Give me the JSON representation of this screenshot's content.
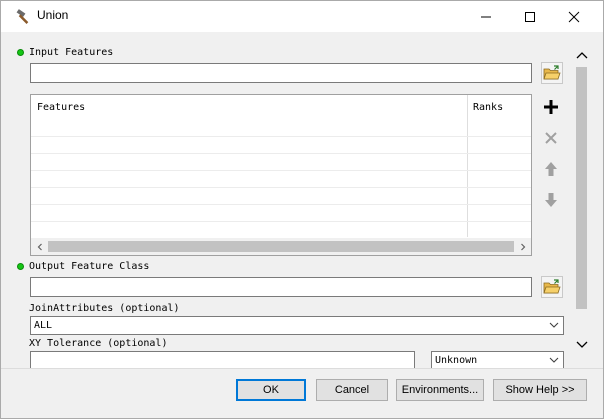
{
  "window": {
    "title": "Union",
    "icon": "hammer-icon"
  },
  "input_features": {
    "label": "Input Features",
    "value": ""
  },
  "features_table": {
    "columns": [
      "Features",
      "Ranks"
    ],
    "rows": []
  },
  "output_feature_class": {
    "label": "Output Feature Class",
    "value": ""
  },
  "join_attributes": {
    "label": "JoinAttributes (optional)",
    "selected": "ALL"
  },
  "xy_tolerance": {
    "label": "XY Tolerance (optional)",
    "value": "",
    "unit": "Unknown"
  },
  "buttons": {
    "ok": "OK",
    "cancel": "Cancel",
    "environments": "Environments...",
    "show_help": "Show Help >>"
  },
  "colors": {
    "required_dot": "#15c615",
    "focus_border": "#0078d7"
  }
}
